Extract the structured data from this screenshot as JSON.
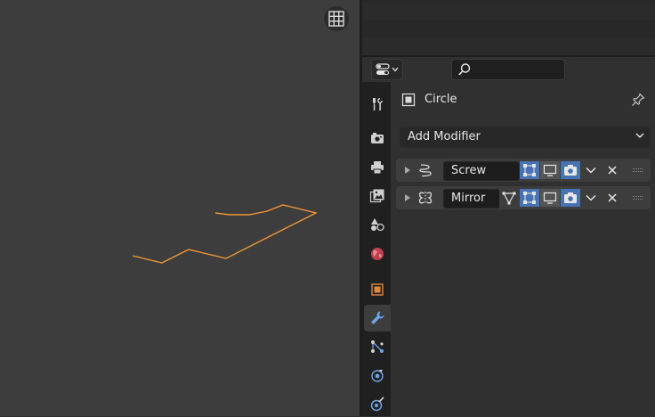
{
  "object": {
    "name": "Circle"
  },
  "add_modifier": {
    "label": "Add Modifier"
  },
  "modifiers": [
    {
      "name": "Screw",
      "icon": "screw-modifier-icon"
    },
    {
      "name": "Mirror",
      "icon": "mirror-modifier-icon"
    }
  ],
  "tabs": [
    "tool",
    "render",
    "output",
    "view-layer",
    "scene",
    "world",
    "object",
    "modifiers",
    "particles",
    "physics",
    "constraints"
  ],
  "colors": {
    "accent": "#4772b3",
    "curve": "#f0953a",
    "viewport_bg": "#3d3d3d"
  }
}
